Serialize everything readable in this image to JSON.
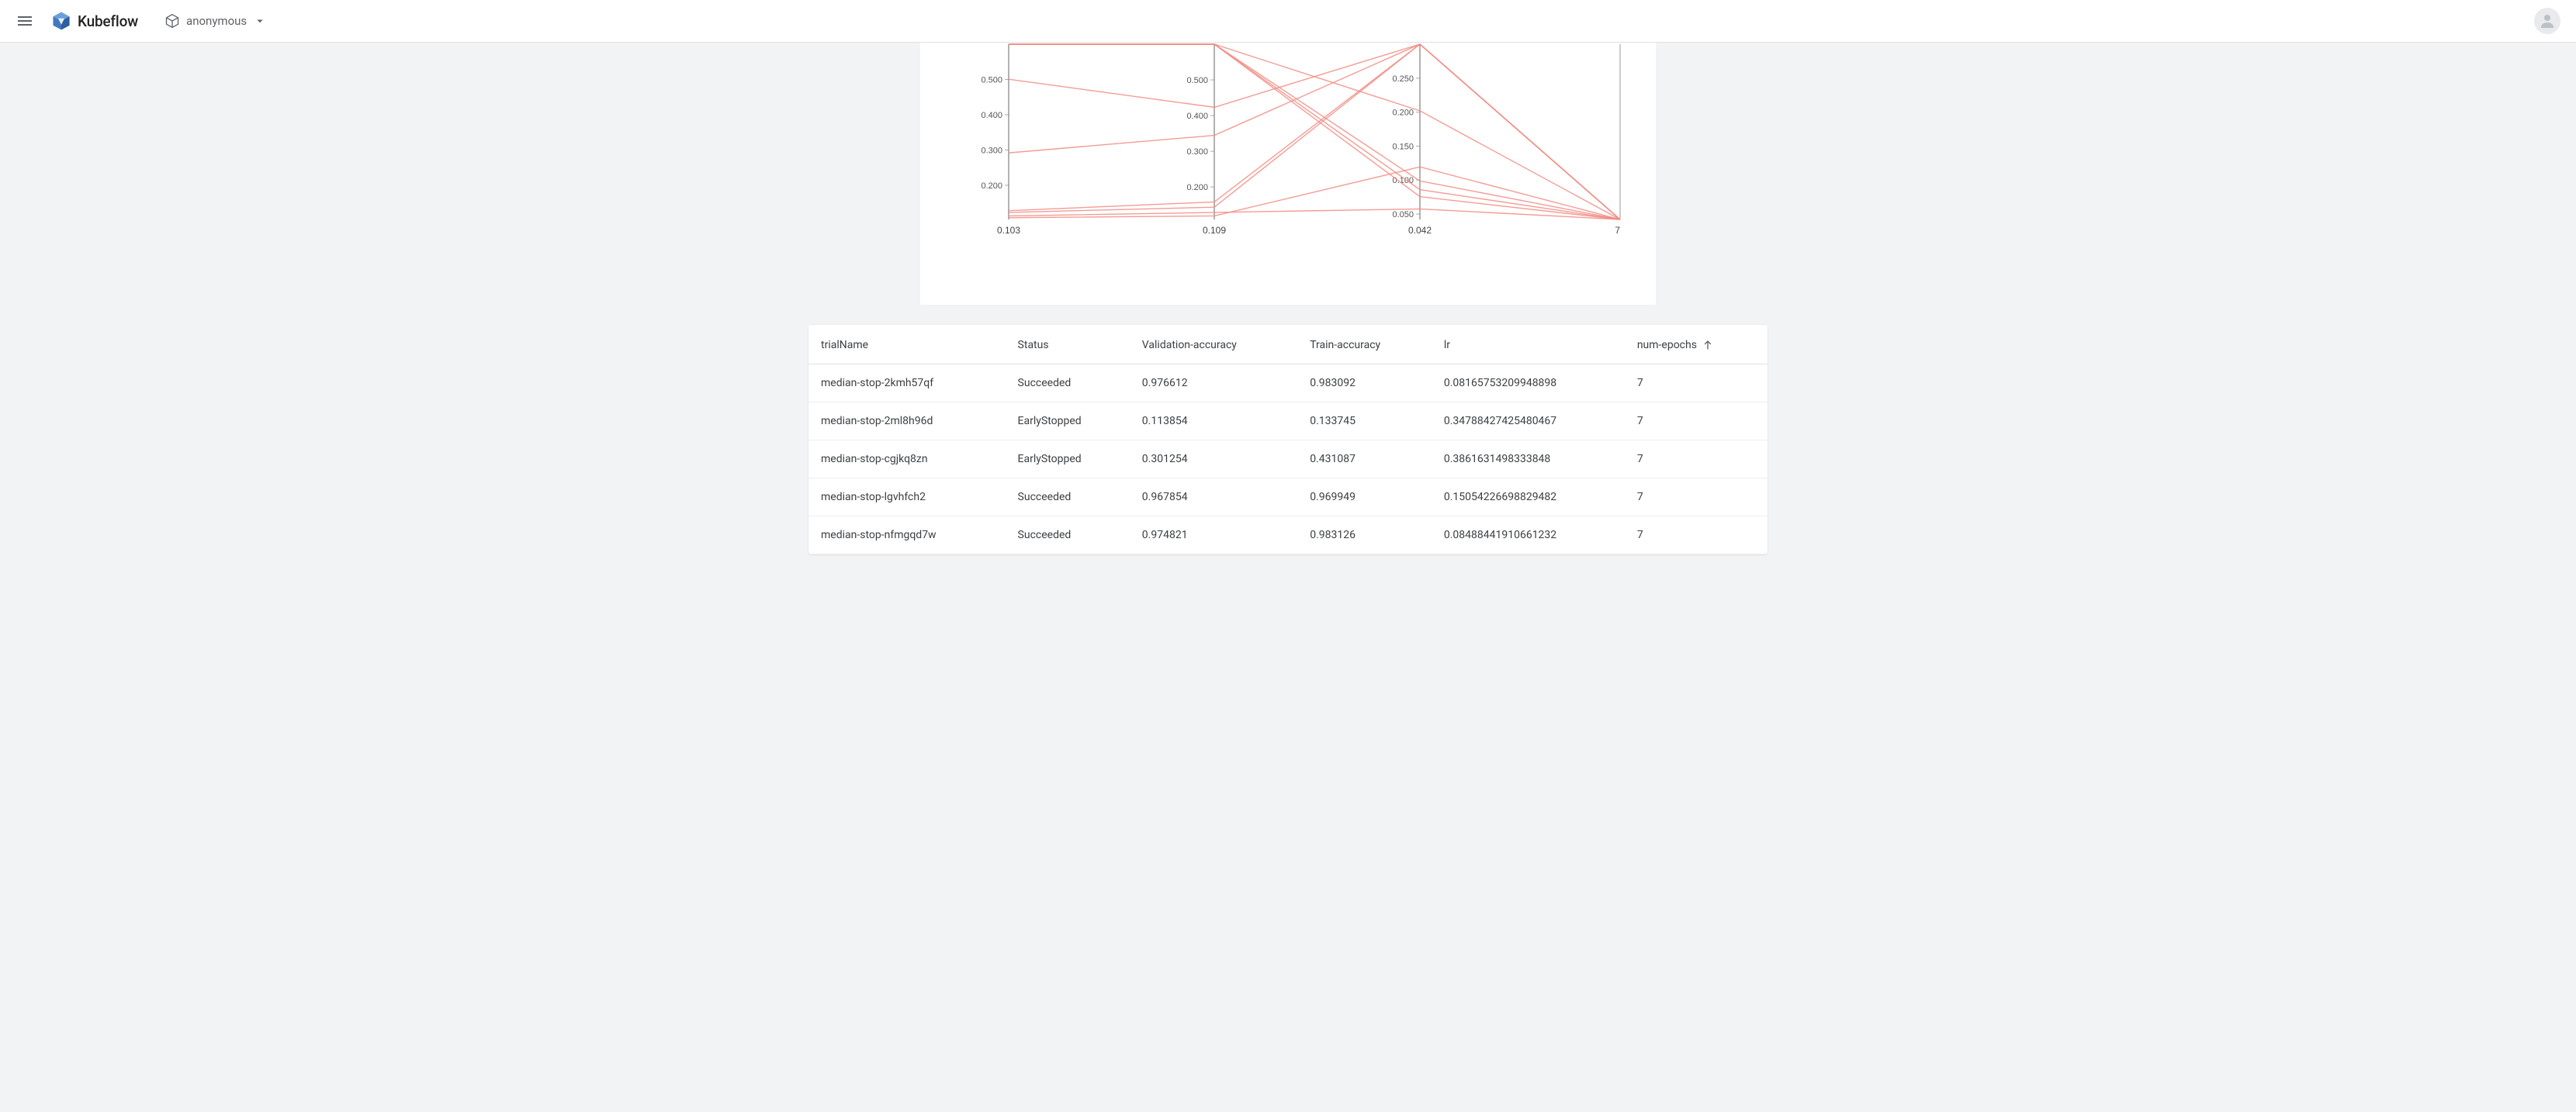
{
  "header": {
    "app_name": "Kubeflow",
    "namespace": "anonymous"
  },
  "table": {
    "columns": [
      {
        "key": "trialName",
        "label": "trialName",
        "sorted": false
      },
      {
        "key": "Status",
        "label": "Status",
        "sorted": false
      },
      {
        "key": "Validation-accuracy",
        "label": "Validation-accuracy",
        "sorted": false
      },
      {
        "key": "Train-accuracy",
        "label": "Train-accuracy",
        "sorted": false
      },
      {
        "key": "lr",
        "label": "lr",
        "sorted": false
      },
      {
        "key": "num-epochs",
        "label": "num-epochs",
        "sorted": true,
        "sort_dir": "asc"
      }
    ],
    "rows": [
      {
        "trialName": "median-stop-2kmh57qf",
        "status": "Succeeded",
        "val": "0.976612",
        "train": "0.983092",
        "lr": "0.08165753209948898",
        "epochs": "7"
      },
      {
        "trialName": "median-stop-2ml8h96d",
        "status": "EarlyStopped",
        "val": "0.113854",
        "train": "0.133745",
        "lr": "0.34788427425480467",
        "epochs": "7"
      },
      {
        "trialName": "median-stop-cgjkq8zn",
        "status": "EarlyStopped",
        "val": "0.301254",
        "train": "0.431087",
        "lr": "0.3861631498333848",
        "epochs": "7"
      },
      {
        "trialName": "median-stop-lgvhfch2",
        "status": "Succeeded",
        "val": "0.967854",
        "train": "0.969949",
        "lr": "0.15054226698829482",
        "epochs": "7"
      },
      {
        "trialName": "median-stop-nfmgqd7w",
        "status": "Succeeded",
        "val": "0.974821",
        "train": "0.983126",
        "lr": "0.08488441910661232",
        "epochs": "7"
      }
    ]
  },
  "chart_data": {
    "type": "parallel-coordinates",
    "axes": [
      {
        "name": "axis1",
        "min": 0.103,
        "max": 0.6,
        "ticks": [
          0.2,
          0.3,
          0.4,
          0.5
        ],
        "bottom_label": "0.103"
      },
      {
        "name": "axis2",
        "min": 0.109,
        "max": 0.6,
        "ticks": [
          0.2,
          0.3,
          0.4,
          0.5
        ],
        "bottom_label": "0.109"
      },
      {
        "name": "axis3",
        "min": 0.042,
        "max": 0.3,
        "ticks": [
          0.05,
          0.1,
          0.15,
          0.2,
          0.25
        ],
        "bottom_label": "0.042"
      },
      {
        "name": "axis4",
        "min": 7,
        "max": 7,
        "ticks": [],
        "bottom_label": "7"
      }
    ],
    "color": "#f28b82",
    "series": [
      {
        "values_norm": [
          1.0,
          1.0,
          0.62,
          0.0
        ]
      },
      {
        "values_norm": [
          1.0,
          1.0,
          0.22,
          0.0
        ]
      },
      {
        "values_norm": [
          1.0,
          1.0,
          0.17,
          0.0
        ]
      },
      {
        "values_norm": [
          1.0,
          1.0,
          0.13,
          0.0
        ]
      },
      {
        "values_norm": [
          0.8,
          0.64,
          1.0,
          0.0
        ]
      },
      {
        "values_norm": [
          0.38,
          0.48,
          1.0,
          0.0
        ]
      },
      {
        "values_norm": [
          0.05,
          0.1,
          1.0,
          0.0
        ]
      },
      {
        "values_norm": [
          0.04,
          0.07,
          1.0,
          0.0
        ]
      },
      {
        "values_norm": [
          0.02,
          0.04,
          0.06,
          0.0
        ]
      },
      {
        "values_norm": [
          0.01,
          0.02,
          0.3,
          0.0
        ]
      }
    ]
  }
}
